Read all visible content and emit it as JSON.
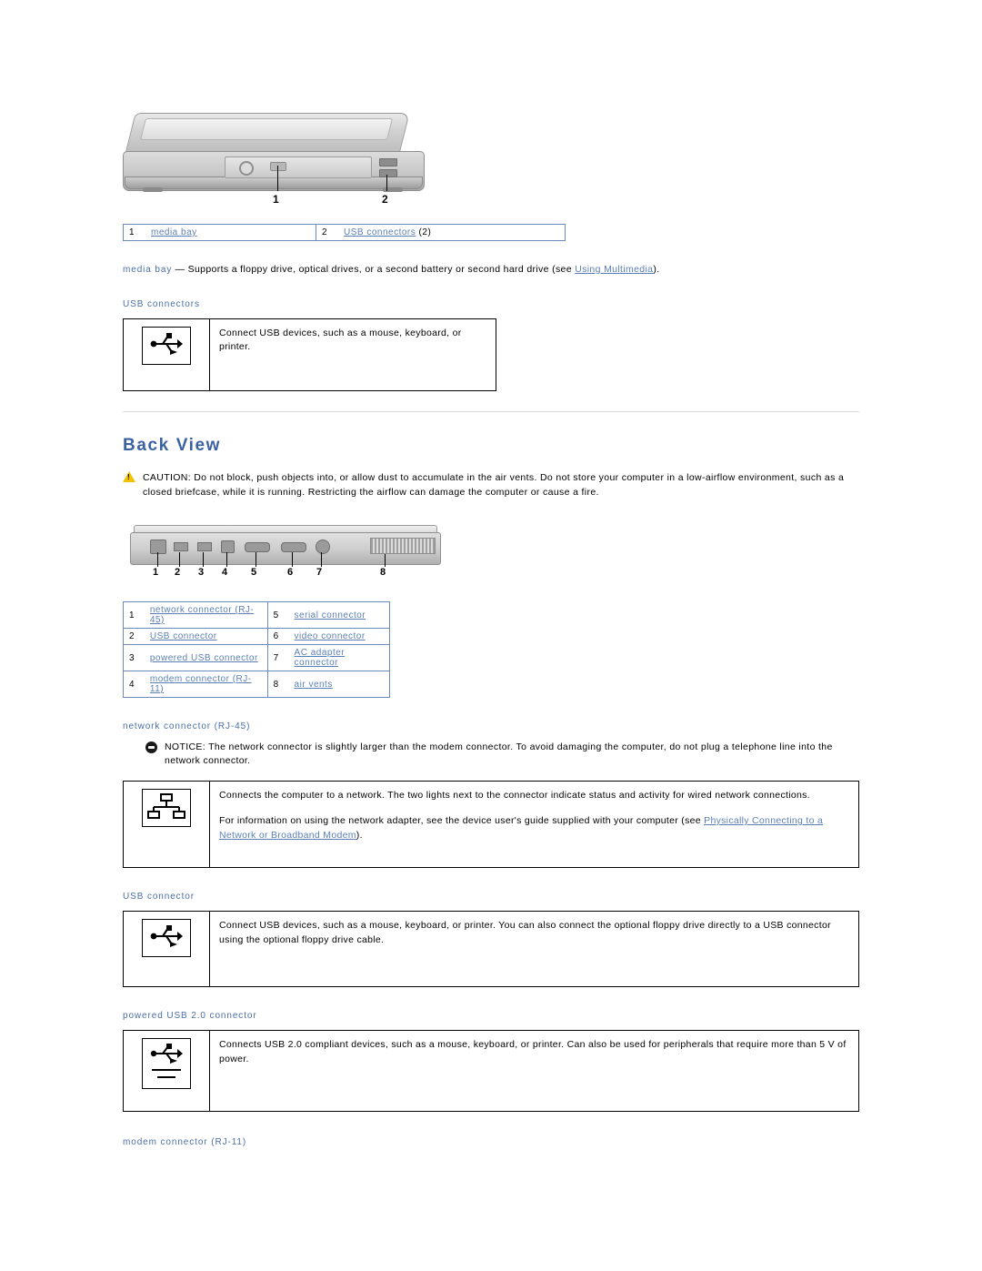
{
  "front_view": {
    "legend": [
      {
        "num": "1",
        "label": "media bay",
        "link": true
      },
      {
        "num": "2",
        "label": "USB connectors",
        "suffix": "(2)",
        "link": true
      }
    ],
    "callouts": [
      "1",
      "2"
    ],
    "media_bay_desc_prefix": "media bay",
    "media_bay_desc": " — Supports a floppy drive, optical drives, or a second battery or second hard drive (see ",
    "media_bay_link": "Using Multimedia",
    "media_bay_suffix": ").",
    "usb_heading": "USB connectors",
    "usb_desc": "Connect USB devices, such as a mouse, keyboard, or printer."
  },
  "back_view": {
    "title": "Back View",
    "caution_label": "CAUTION:",
    "caution_text": " Do not block, push objects into, or allow dust to accumulate in the air vents. Do not store your computer in a low-airflow environment, such as a closed briefcase, while it is running. Restricting the airflow can damage the computer or cause a fire.",
    "callouts": [
      "1",
      "2",
      "3",
      "4",
      "5",
      "6",
      "7",
      "8"
    ],
    "legend_left": [
      {
        "num": "1",
        "label": "network connector (RJ-45)"
      },
      {
        "num": "2",
        "label": "USB connector"
      },
      {
        "num": "3",
        "label": "powered USB connector"
      },
      {
        "num": "4",
        "label": "modem connector (RJ-11)"
      }
    ],
    "legend_right": [
      {
        "num": "5",
        "label": "serial connector"
      },
      {
        "num": "6",
        "label": "video connector"
      },
      {
        "num": "7",
        "label": "AC adapter connector"
      },
      {
        "num": "8",
        "label": "air vents"
      }
    ],
    "network": {
      "heading": "network connector (RJ-45)",
      "notice_label": "NOTICE:",
      "notice_text": " The network connector is slightly larger than the modem connector. To avoid damaging the computer, do not plug a telephone line into the network connector.",
      "desc_p1": "Connects the computer to a network. The two lights next to the connector indicate status and activity for wired network connections.",
      "desc_p2_a": "For information on using the network adapter, see the device user's guide supplied with your computer (see ",
      "desc_p2_link": "Physically Connecting to a Network or Broadband Modem",
      "desc_p2_b": ")."
    },
    "usb": {
      "heading": "USB connector",
      "desc": "Connect USB devices, such as a mouse, keyboard, or printer. You can also connect the optional floppy drive directly to a USB connector using the optional floppy drive cable."
    },
    "powered_usb": {
      "heading": "powered USB 2.0 connector",
      "desc": "Connects USB 2.0 compliant devices, such as a mouse, keyboard, or printer. Can also be used for peripherals that require more than 5 V of power."
    },
    "modem": {
      "heading": "modem connector (RJ-11)"
    }
  },
  "icons": {
    "usb": "usb-symbol-icon",
    "network": "network-symbol-icon",
    "powered_usb": "powered-usb-symbol-icon"
  },
  "colors": {
    "link": "#5b7fb4",
    "heading": "#3a62a0",
    "label": "#4a6fa5",
    "table_border": "#6b8cba",
    "caution": "#f2c200"
  }
}
